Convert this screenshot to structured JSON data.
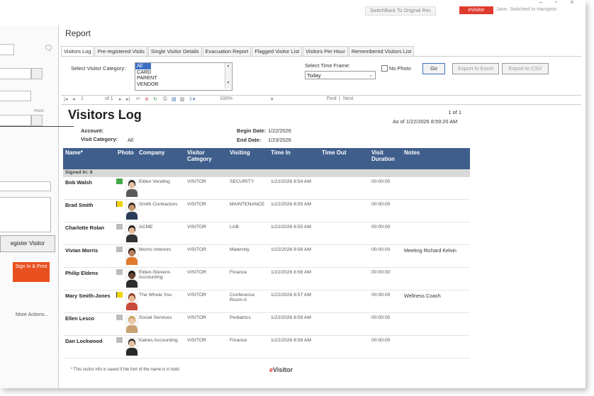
{
  "window": {
    "user_box": "SwitchBack To Original Rec",
    "brand_tab": "eVisitor",
    "info_text": "Jane, Switched to Hampton"
  },
  "left_pane": {
    "field_label": "Host",
    "register_button": "egister Visitor",
    "signin_print": "Sign In & Print",
    "more_actions": "More Actions..."
  },
  "report": {
    "heading": "Report",
    "tabs": [
      "Visitors Log",
      "Pre-registered Visits",
      "Single Visitor Details",
      "Evacuation Report",
      "Flagged Visitor List",
      "Visitors Per Hour",
      "Remembered Visitors List"
    ],
    "active_tab": 0
  },
  "filters": {
    "category_label": "Select Visitor Category:",
    "categories": [
      "All",
      "CARD",
      "PARENT",
      "VENDOR"
    ],
    "selected_category": "All",
    "timeframe_label": "Select Time Frame:",
    "timeframe_value": "Today",
    "no_photo_label": "No Photo",
    "go_button": "Go",
    "export_excel": "Export to Excel",
    "export_csv": "Export to CSV"
  },
  "toolbar": {
    "page_box": "1",
    "page_of": "of 1",
    "zoom": "100%",
    "find": "Find",
    "next": "Next"
  },
  "doc": {
    "title": "Visitors Log",
    "page": "1 of 1",
    "as_of": "As of 1/22/2026 8:59:20 AM",
    "account_label": "Account:",
    "account_value": "",
    "visit_category_label": "Visit Category:",
    "visit_category_value": "All",
    "begin_label": "Begin Date:",
    "begin_value": "1/22/2026",
    "end_label": "End Date:",
    "end_value": "1/23/2026",
    "columns": [
      "Name*",
      "Photo",
      "Company",
      "Visitor Category",
      "Visiting",
      "Time In",
      "Time Out",
      "Visit Duration",
      "Notes"
    ],
    "group_label": "Signed In: 8",
    "rows": [
      {
        "name": "Bob Walsh",
        "flag": "green",
        "company": "Elden Vending",
        "category": "VISITOR",
        "visiting": "SECURITY",
        "time_in": "1/22/2026 8:54 AM",
        "time_out": "",
        "duration": "00:00:00",
        "notes": "",
        "photo": "suit-gray"
      },
      {
        "name": "Brad Smith",
        "flag": "yellow",
        "company": "Smith Contractors",
        "category": "VISITOR",
        "visiting": "MAINTENANCE",
        "time_in": "1/22/2026 8:55 AM",
        "time_out": "",
        "duration": "00:00:00",
        "notes": "",
        "photo": "casual-dark"
      },
      {
        "name": "Charlotte Rolan",
        "flag": "none",
        "company": "ACME",
        "category": "VISITOR",
        "visiting": "LAB",
        "time_in": "1/22/2026 8:55 AM",
        "time_out": "",
        "duration": "00:00:00",
        "notes": "",
        "photo": "woman-dark"
      },
      {
        "name": "Vivian Morris",
        "flag": "none",
        "company": "Morris Interiors",
        "category": "VISITOR",
        "visiting": "Maternity",
        "time_in": "1/22/2026 8:56 AM",
        "time_out": "",
        "duration": "00:00:00",
        "notes": "Meeting Richard Kelvin",
        "photo": "woman-orange"
      },
      {
        "name": "Philip Eldens",
        "flag": "none",
        "company": "Elden-Stevens Accounting",
        "category": "VISITOR",
        "visiting": "Finance",
        "time_in": "1/22/2026 8:56 AM",
        "time_out": "",
        "duration": "00:00:00",
        "notes": "",
        "photo": "man-dark"
      },
      {
        "name": "Mary Smith-Jones",
        "flag": "yellow",
        "company": "The Whole You",
        "category": "VISITOR",
        "visiting": "Conference Room A",
        "time_in": "1/22/2026 8:57 AM",
        "time_out": "",
        "duration": "00:00:00",
        "notes": "Wellness Coach",
        "photo": "woman-red"
      },
      {
        "name": "Ellen Lesco",
        "flag": "none",
        "company": "Social Services",
        "category": "VISITOR",
        "visiting": "Pediatrics",
        "time_in": "1/22/2026 8:58 AM",
        "time_out": "",
        "duration": "00:00:00",
        "notes": "",
        "photo": "woman-blonde"
      },
      {
        "name": "Dan Lockwood",
        "flag": "none",
        "company": "Katres Accounting",
        "category": "VISITOR",
        "visiting": "Finance",
        "time_in": "1/22/2026 8:58 AM",
        "time_out": "",
        "duration": "00:00:00",
        "notes": "",
        "photo": "man-suit"
      }
    ],
    "footnote": "* This visitor info is saved if the font of the name is in bold.",
    "brand": "Visitor",
    "brand_prefix": "e"
  },
  "colors": {
    "header_bg": "#3f5e8c",
    "brand_red": "#e03a2f",
    "signin_orange": "#e8501f",
    "flag_green": "#45a84a",
    "flag_yellow": "#f2d40b"
  }
}
